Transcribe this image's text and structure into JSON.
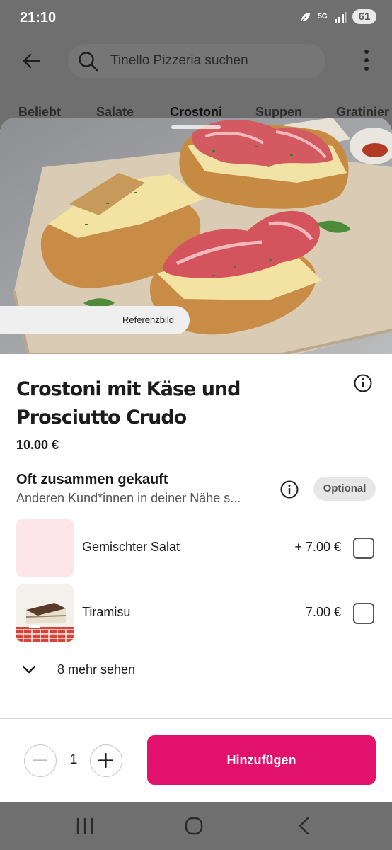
{
  "status": {
    "time": "21:10",
    "network": "5G",
    "battery": "61"
  },
  "header": {
    "search_placeholder": "Tinello Pizzeria suchen"
  },
  "tabs": [
    "Beliebt",
    "Salate",
    "Crostoni",
    "Suppen",
    "Gratinier"
  ],
  "active_tab": "Crostoni",
  "product": {
    "image_badge": "Referenzbild",
    "title": "Crostoni mit Käse und Prosciutto Crudo",
    "price": "10.00 €"
  },
  "addons": {
    "title": "Oft zusammen gekauft",
    "subtitle": "Anderen Kund*innen in deiner Nähe s...",
    "badge": "Optional",
    "items": [
      {
        "name": "Gemischter Salat",
        "price": "+ 7.00 €",
        "checked": false
      },
      {
        "name": "Tiramisu",
        "price": "7.00 €",
        "checked": false
      }
    ],
    "more_label": "8 mehr sehen"
  },
  "footer": {
    "quantity": "1",
    "add_label": "Hinzufügen"
  },
  "colors": {
    "accent": "#e2116b",
    "overlay": "#6f6f6f"
  }
}
